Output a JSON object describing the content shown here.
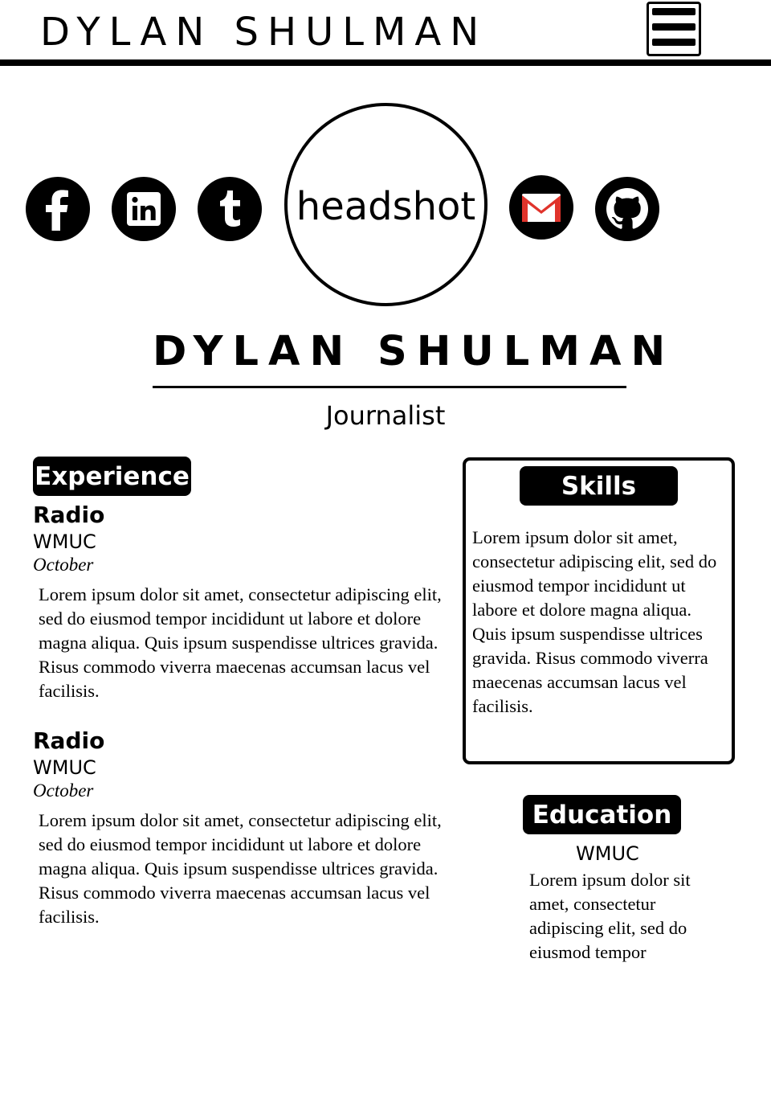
{
  "header": {
    "site_title": "DYLAN SHULMAN",
    "menu_icon": "hamburger-menu-icon"
  },
  "social": [
    {
      "name": "facebook",
      "icon": "facebook-icon"
    },
    {
      "name": "linkedin",
      "icon": "linkedin-icon"
    },
    {
      "name": "tumblr",
      "icon": "tumblr-icon"
    },
    {
      "name": "gmail",
      "icon": "gmail-icon",
      "accent": "#e0332b"
    },
    {
      "name": "github",
      "icon": "github-icon"
    }
  ],
  "profile": {
    "headshot_label": "headshot",
    "name": "DYLAN SHULMAN",
    "role": "Journalist"
  },
  "experience": {
    "heading": "Experience",
    "entries": [
      {
        "title": "Radio",
        "org": "WMUC",
        "date": "October",
        "description": "Lorem ipsum dolor sit amet, consectetur adipiscing elit, sed do eiusmod tempor incididunt ut labore et dolore magna aliqua. Quis ipsum suspendisse ultrices gravida. Risus commodo viverra maecenas accumsan lacus vel facilisis."
      },
      {
        "title": "Radio",
        "org": "WMUC",
        "date": "October",
        "description": "Lorem ipsum dolor sit amet, consectetur adipiscing elit, sed do eiusmod tempor incididunt ut labore et dolore magna aliqua. Quis ipsum suspendisse ultrices gravida. Risus commodo viverra maecenas accumsan lacus vel facilisis."
      }
    ]
  },
  "skills": {
    "heading": "Skills",
    "text": "Lorem ipsum dolor sit amet, consectetur adipiscing elit, sed do eiusmod tempor incididunt ut labore et dolore magna aliqua. Quis ipsum suspendisse ultrices gravida. Risus commodo viverra maecenas accumsan lacus vel facilisis."
  },
  "education": {
    "heading": "Education",
    "org": "WMUC",
    "text": "Lorem ipsum dolor sit amet, consectetur adipiscing elit, sed do eiusmod tempor"
  }
}
